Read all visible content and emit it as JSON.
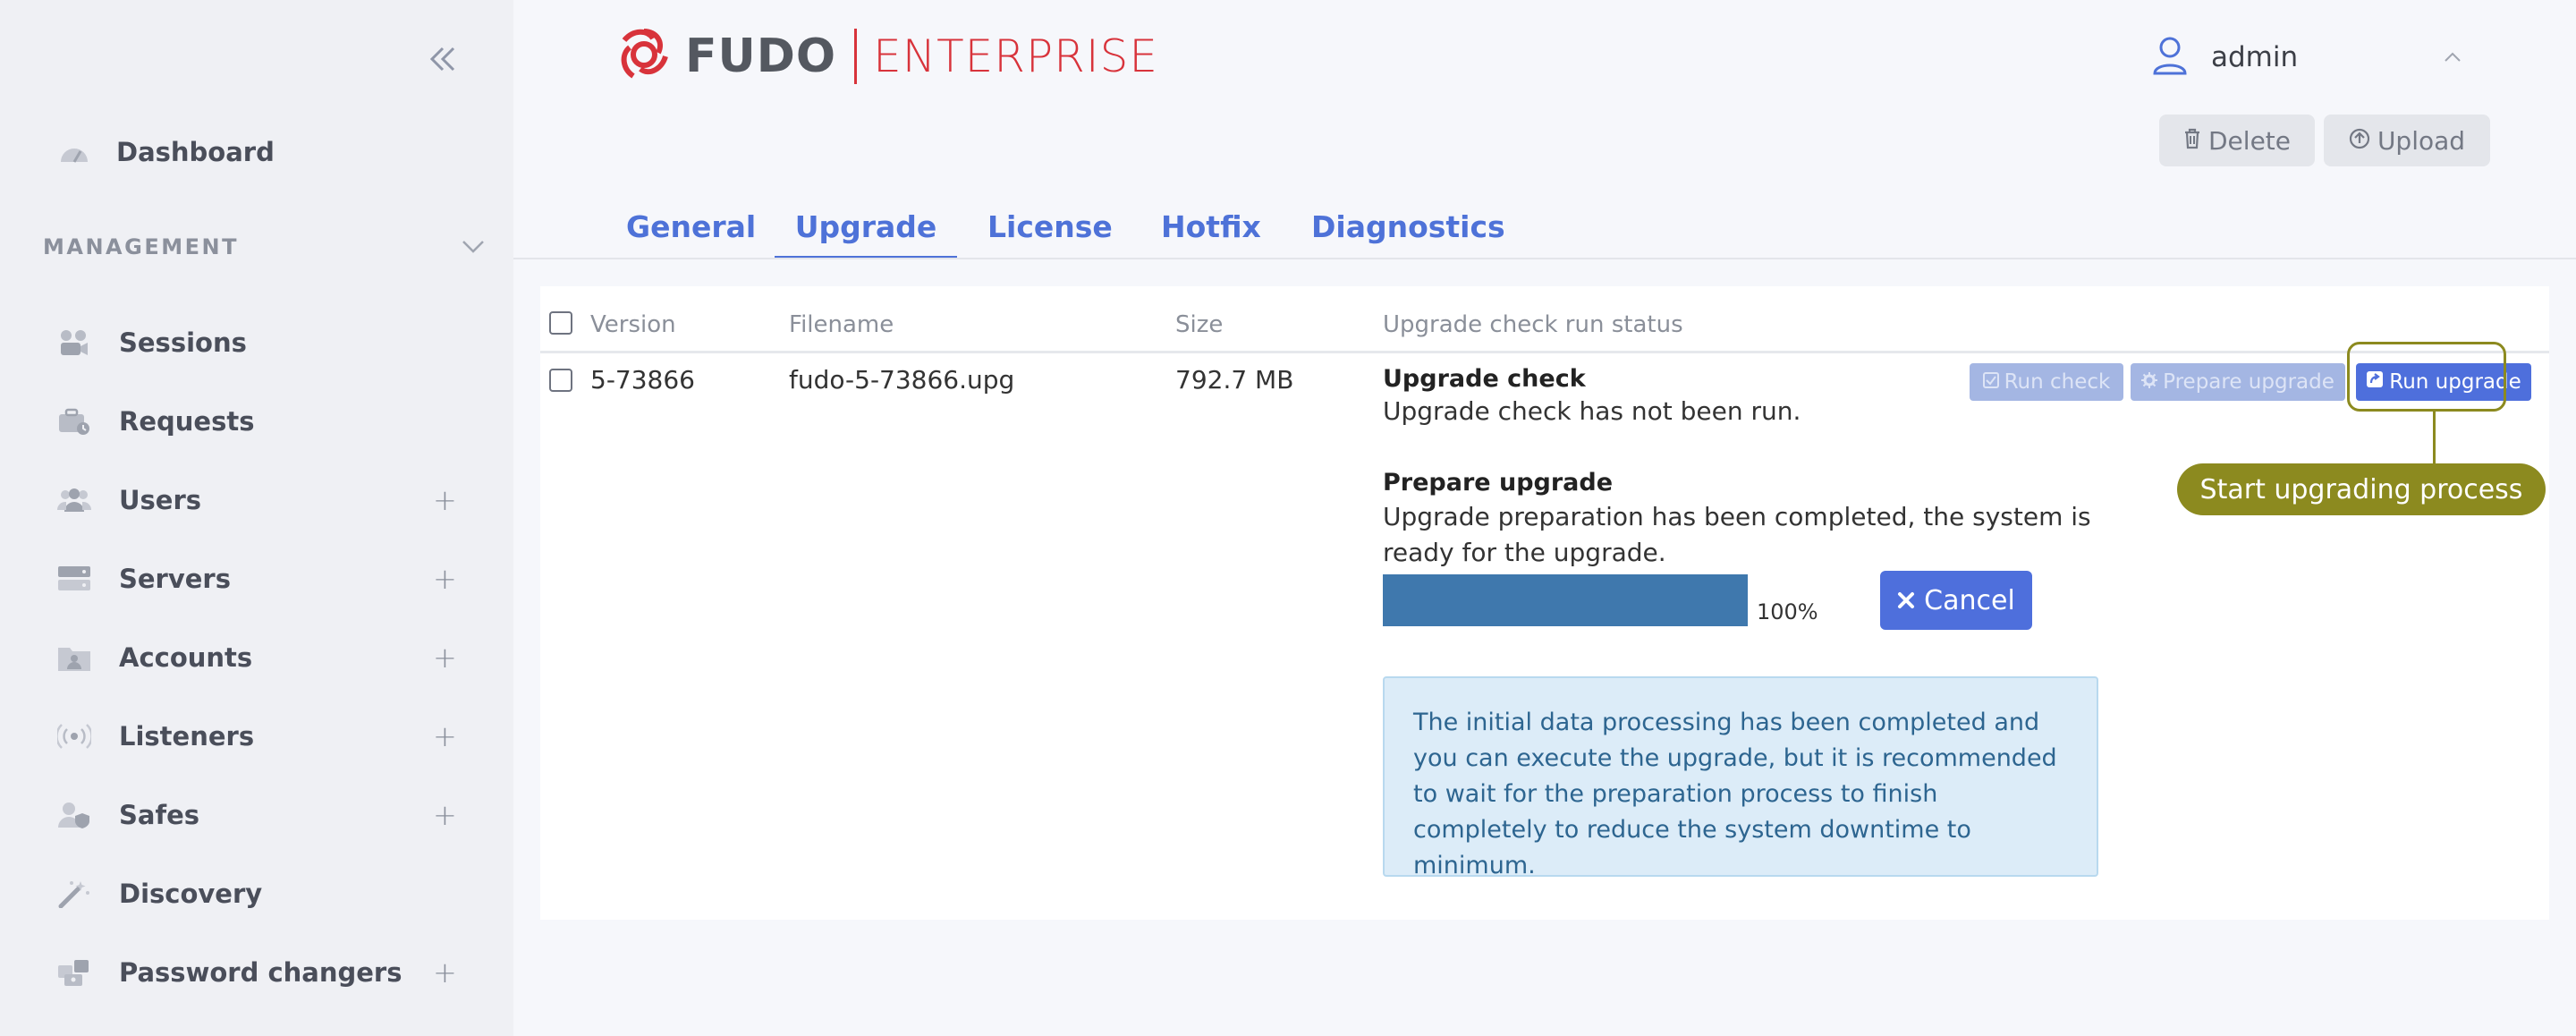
{
  "brand": {
    "name": "FUDO",
    "edition": "ENTERPRISE",
    "accent": "#d8333b"
  },
  "user": {
    "name": "admin"
  },
  "toolbar": {
    "delete_label": "Delete",
    "upload_label": "Upload"
  },
  "sidebar": {
    "dashboard": {
      "label": "Dashboard",
      "icon": "dashboard-icon"
    },
    "section_label": "MANAGEMENT",
    "items": [
      {
        "label": "Sessions",
        "icon": "sessions-icon",
        "has_add": false
      },
      {
        "label": "Requests",
        "icon": "requests-icon",
        "has_add": false
      },
      {
        "label": "Users",
        "icon": "users-icon",
        "has_add": true
      },
      {
        "label": "Servers",
        "icon": "servers-icon",
        "has_add": true
      },
      {
        "label": "Accounts",
        "icon": "accounts-icon",
        "has_add": true
      },
      {
        "label": "Listeners",
        "icon": "listeners-icon",
        "has_add": true
      },
      {
        "label": "Safes",
        "icon": "safes-icon",
        "has_add": true
      },
      {
        "label": "Discovery",
        "icon": "discovery-icon",
        "has_add": false
      },
      {
        "label": "Password changers",
        "icon": "password-changers-icon",
        "has_add": true
      }
    ],
    "add_symbol": "+"
  },
  "tabs": [
    {
      "label": "General",
      "active": false
    },
    {
      "label": "Upgrade",
      "active": true
    },
    {
      "label": "License",
      "active": false
    },
    {
      "label": "Hotfix",
      "active": false
    },
    {
      "label": "Diagnostics",
      "active": false
    }
  ],
  "table": {
    "columns": {
      "version": "Version",
      "filename": "Filename",
      "size": "Size",
      "status": "Upgrade check run status"
    },
    "row": {
      "version": "5-73866",
      "filename": "fudo-5-73866.upg",
      "size": "792.7 MB"
    }
  },
  "upgrade_check": {
    "title": "Upgrade check",
    "text": "Upgrade check has not been run."
  },
  "prepare_upgrade": {
    "title": "Prepare upgrade",
    "text_line1": "Upgrade preparation has been completed, the system is",
    "text_line2": "ready for the upgrade.",
    "progress": 100,
    "progress_label": "100%",
    "cancel_label": "Cancel"
  },
  "actions": {
    "run_check_label": "Run check",
    "prepare_upgrade_label": "Prepare upgrade",
    "run_upgrade_label": "Run upgrade"
  },
  "info_message": "The initial data processing has been completed and you can execute the upgrade, but it is recommended to wait for the preparation process to finish completely to reduce the system downtime to minimum.",
  "callout": {
    "label": "Start upgrading process",
    "color": "#8c8a1f"
  },
  "colors": {
    "primary": "#4e6fdc",
    "tab": "#4e72d8",
    "progress": "#3f78ad",
    "alert_bg": "#dcecf8"
  }
}
